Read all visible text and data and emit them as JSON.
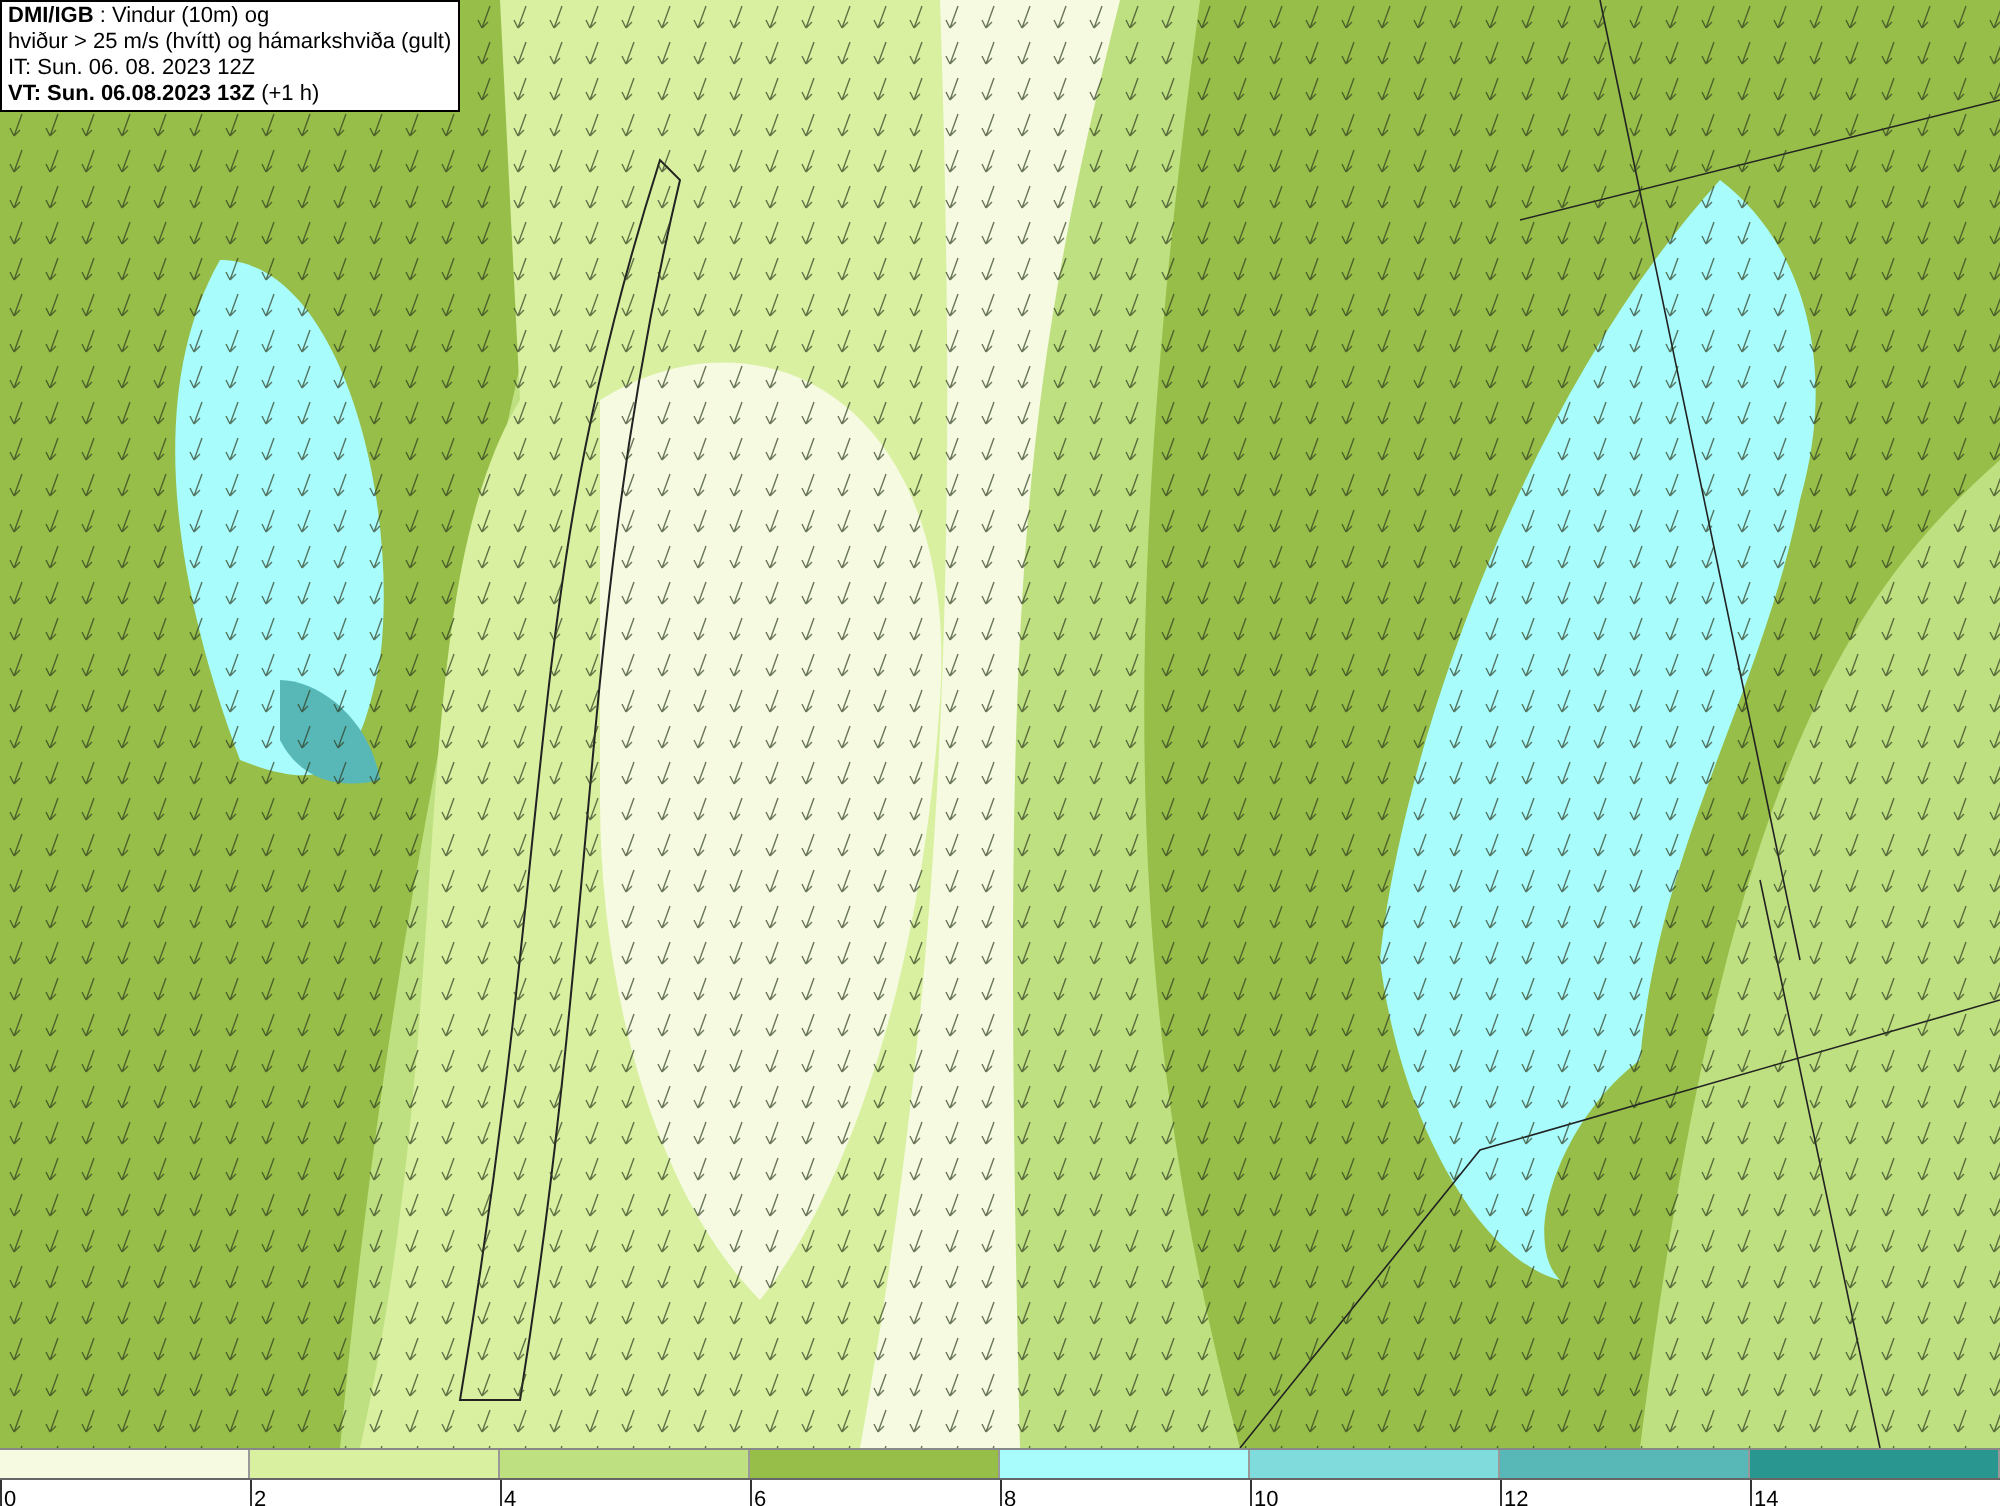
{
  "header": {
    "lines": [
      "**DMI/IGB** : Vindur (10m) og",
      "hviður > 25 m/s (hvítt) og hámarkshviða (gult)",
      "IT: Sun. 06. 08. 2023 12Z",
      "**VT: Sun. 06.08.2023 13Z** (+1 h)"
    ]
  },
  "legend": [
    {
      "label": "0",
      "color": "#f5fae0"
    },
    {
      "label": "2",
      "color": "#d8f0a0"
    },
    {
      "label": "4",
      "color": "#bfe080"
    },
    {
      "label": "6",
      "color": "#96be48"
    },
    {
      "label": "8",
      "color": "#a8fcfc"
    },
    {
      "label": "10",
      "color": "#80dcdc"
    },
    {
      "label": "12",
      "color": "#58b8b8"
    },
    {
      "label": "14",
      "color": "#2a9690"
    }
  ]
}
